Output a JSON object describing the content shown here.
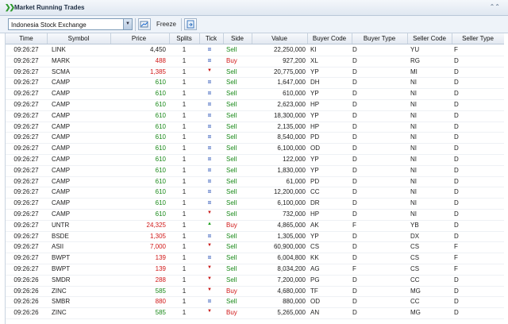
{
  "window": {
    "title": "Market Running Trades",
    "collapse_icon": "double-chevron-up"
  },
  "toolbar": {
    "exchange": "Indonesia Stock Exchange",
    "freeze_label": "Freeze"
  },
  "columns": [
    "Time",
    "Symbol",
    "Price",
    "Splits",
    "Tick",
    "Side",
    "Value",
    "Buyer Code",
    "Buyer Type",
    "Seller Code",
    "Seller Type"
  ],
  "colors": {
    "up": "#1a8a1a",
    "down": "#d01818",
    "unchanged": "#1144aa"
  },
  "rows": [
    {
      "time": "09:26:27",
      "symbol": "LINK",
      "price": "4,450",
      "pc": "n",
      "splits": "1",
      "tick": "eq",
      "side": "Sell",
      "value": "22,250,000",
      "bc": "KI",
      "bt": "D",
      "sc": "YU",
      "st": "F"
    },
    {
      "time": "09:26:27",
      "symbol": "MARK",
      "price": "488",
      "pc": "r",
      "splits": "1",
      "tick": "eq",
      "side": "Buy",
      "value": "927,200",
      "bc": "XL",
      "bt": "D",
      "sc": "RG",
      "st": "D"
    },
    {
      "time": "09:26:27",
      "symbol": "SCMA",
      "price": "1,385",
      "pc": "r",
      "splits": "1",
      "tick": "down",
      "side": "Sell",
      "value": "20,775,000",
      "bc": "YP",
      "bt": "D",
      "sc": "MI",
      "st": "D"
    },
    {
      "time": "09:26:27",
      "symbol": "CAMP",
      "price": "610",
      "pc": "g",
      "splits": "1",
      "tick": "eq",
      "side": "Sell",
      "value": "1,647,000",
      "bc": "DH",
      "bt": "D",
      "sc": "NI",
      "st": "D"
    },
    {
      "time": "09:26:27",
      "symbol": "CAMP",
      "price": "610",
      "pc": "g",
      "splits": "1",
      "tick": "eq",
      "side": "Sell",
      "value": "610,000",
      "bc": "YP",
      "bt": "D",
      "sc": "NI",
      "st": "D"
    },
    {
      "time": "09:26:27",
      "symbol": "CAMP",
      "price": "610",
      "pc": "g",
      "splits": "1",
      "tick": "eq",
      "side": "Sell",
      "value": "2,623,000",
      "bc": "HP",
      "bt": "D",
      "sc": "NI",
      "st": "D"
    },
    {
      "time": "09:26:27",
      "symbol": "CAMP",
      "price": "610",
      "pc": "g",
      "splits": "1",
      "tick": "eq",
      "side": "Sell",
      "value": "18,300,000",
      "bc": "YP",
      "bt": "D",
      "sc": "NI",
      "st": "D"
    },
    {
      "time": "09:26:27",
      "symbol": "CAMP",
      "price": "610",
      "pc": "g",
      "splits": "1",
      "tick": "eq",
      "side": "Sell",
      "value": "2,135,000",
      "bc": "HP",
      "bt": "D",
      "sc": "NI",
      "st": "D"
    },
    {
      "time": "09:26:27",
      "symbol": "CAMP",
      "price": "610",
      "pc": "g",
      "splits": "1",
      "tick": "eq",
      "side": "Sell",
      "value": "8,540,000",
      "bc": "PD",
      "bt": "D",
      "sc": "NI",
      "st": "D"
    },
    {
      "time": "09:26:27",
      "symbol": "CAMP",
      "price": "610",
      "pc": "g",
      "splits": "1",
      "tick": "eq",
      "side": "Sell",
      "value": "6,100,000",
      "bc": "OD",
      "bt": "D",
      "sc": "NI",
      "st": "D"
    },
    {
      "time": "09:26:27",
      "symbol": "CAMP",
      "price": "610",
      "pc": "g",
      "splits": "1",
      "tick": "eq",
      "side": "Sell",
      "value": "122,000",
      "bc": "YP",
      "bt": "D",
      "sc": "NI",
      "st": "D"
    },
    {
      "time": "09:26:27",
      "symbol": "CAMP",
      "price": "610",
      "pc": "g",
      "splits": "1",
      "tick": "eq",
      "side": "Sell",
      "value": "1,830,000",
      "bc": "YP",
      "bt": "D",
      "sc": "NI",
      "st": "D"
    },
    {
      "time": "09:26:27",
      "symbol": "CAMP",
      "price": "610",
      "pc": "g",
      "splits": "1",
      "tick": "eq",
      "side": "Sell",
      "value": "61,000",
      "bc": "PD",
      "bt": "D",
      "sc": "NI",
      "st": "D"
    },
    {
      "time": "09:26:27",
      "symbol": "CAMP",
      "price": "610",
      "pc": "g",
      "splits": "1",
      "tick": "eq",
      "side": "Sell",
      "value": "12,200,000",
      "bc": "CC",
      "bt": "D",
      "sc": "NI",
      "st": "D"
    },
    {
      "time": "09:26:27",
      "symbol": "CAMP",
      "price": "610",
      "pc": "g",
      "splits": "1",
      "tick": "eq",
      "side": "Sell",
      "value": "6,100,000",
      "bc": "DR",
      "bt": "D",
      "sc": "NI",
      "st": "D"
    },
    {
      "time": "09:26:27",
      "symbol": "CAMP",
      "price": "610",
      "pc": "g",
      "splits": "1",
      "tick": "down",
      "side": "Sell",
      "value": "732,000",
      "bc": "HP",
      "bt": "D",
      "sc": "NI",
      "st": "D"
    },
    {
      "time": "09:26:27",
      "symbol": "UNTR",
      "price": "24,325",
      "pc": "r",
      "splits": "1",
      "tick": "up",
      "side": "Buy",
      "value": "4,865,000",
      "bc": "AK",
      "bt": "F",
      "sc": "YB",
      "st": "D"
    },
    {
      "time": "09:26:27",
      "symbol": "BSDE",
      "price": "1,305",
      "pc": "r",
      "splits": "1",
      "tick": "eq",
      "side": "Sell",
      "value": "1,305,000",
      "bc": "YP",
      "bt": "D",
      "sc": "DX",
      "st": "D"
    },
    {
      "time": "09:26:27",
      "symbol": "ASII",
      "price": "7,000",
      "pc": "r",
      "splits": "1",
      "tick": "down",
      "side": "Sell",
      "value": "60,900,000",
      "bc": "CS",
      "bt": "D",
      "sc": "CS",
      "st": "F"
    },
    {
      "time": "09:26:27",
      "symbol": "BWPT",
      "price": "139",
      "pc": "r",
      "splits": "1",
      "tick": "eq",
      "side": "Sell",
      "value": "6,004,800",
      "bc": "KK",
      "bt": "D",
      "sc": "CS",
      "st": "F"
    },
    {
      "time": "09:26:27",
      "symbol": "BWPT",
      "price": "139",
      "pc": "r",
      "splits": "1",
      "tick": "down",
      "side": "Sell",
      "value": "8,034,200",
      "bc": "AG",
      "bt": "F",
      "sc": "CS",
      "st": "F"
    },
    {
      "time": "09:26:26",
      "symbol": "SMDR",
      "price": "288",
      "pc": "r",
      "splits": "1",
      "tick": "down",
      "side": "Sell",
      "value": "7,200,000",
      "bc": "PG",
      "bt": "D",
      "sc": "CC",
      "st": "D"
    },
    {
      "time": "09:26:26",
      "symbol": "ZINC",
      "price": "585",
      "pc": "g",
      "splits": "1",
      "tick": "down",
      "side": "Buy",
      "value": "4,680,000",
      "bc": "TF",
      "bt": "D",
      "sc": "MG",
      "st": "D"
    },
    {
      "time": "09:26:26",
      "symbol": "SMBR",
      "price": "880",
      "pc": "r",
      "splits": "1",
      "tick": "eq",
      "side": "Sell",
      "value": "880,000",
      "bc": "OD",
      "bt": "D",
      "sc": "CC",
      "st": "D"
    },
    {
      "time": "09:26:26",
      "symbol": "ZINC",
      "price": "585",
      "pc": "g",
      "splits": "1",
      "tick": "down",
      "side": "Buy",
      "value": "5,265,000",
      "bc": "AN",
      "bt": "D",
      "sc": "MG",
      "st": "D"
    }
  ]
}
